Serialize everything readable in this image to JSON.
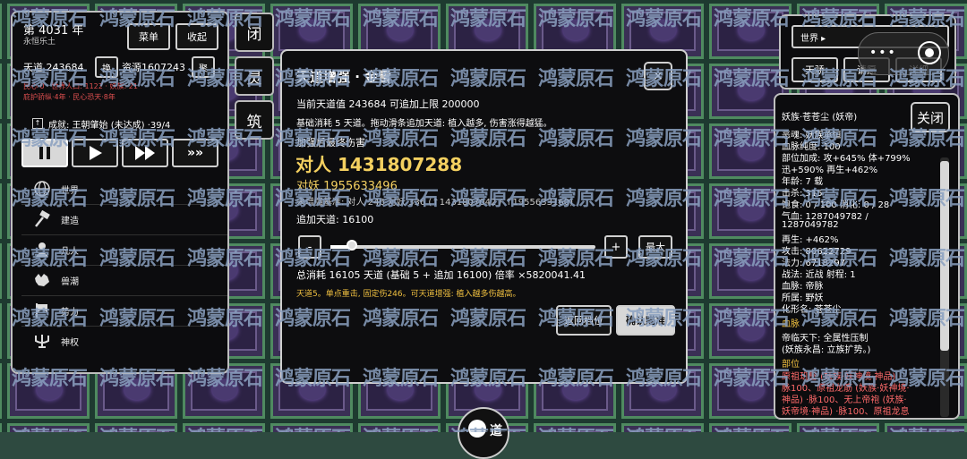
{
  "background": {
    "tile_text": "鸿蒙原石"
  },
  "top_left": {
    "year": "第 4031 年",
    "realm": "永恒乐土",
    "menu_label": "菜单",
    "collapse_label": "收起",
    "tiandao_label": "天道 243684",
    "swap_label": "换",
    "resource_label": "资源1607243",
    "gather_label": "聚",
    "stats_line1": "民心 0 · 世界人口: 1122 · 妖族: 21",
    "stats_line2": "庇护骄纵·4年 · 民心恐天·8年",
    "achievement_label": "成就: 王朝肇始 (未达成) ·39/4",
    "speed_buttons": [
      "pause",
      "play",
      "fast",
      "fastest"
    ],
    "nav_items": [
      {
        "icon": "globe-icon",
        "label": "世界"
      },
      {
        "icon": "hammer-icon",
        "label": "建造"
      },
      {
        "icon": "person-icon",
        "label": "凡人"
      },
      {
        "icon": "beast-icon",
        "label": "兽潮"
      },
      {
        "icon": "banner-icon",
        "label": "势力"
      },
      {
        "icon": "trident-icon",
        "label": "神权"
      }
    ]
  },
  "vertical_buttons": [
    "闭",
    "灵",
    "筑"
  ],
  "dialog": {
    "title": "天道增强 · 金雷",
    "close_symbol": "×",
    "line_current": "当前天道值  243684    可追加上限  200000",
    "line_cost": "基础消耗 5 天道。拖动滑条追加天道: 植入越多, 伤害涨得越猛。",
    "final_damage_label": "加强后最终伤害",
    "vs_human": "对人  1431807288",
    "vs_yao": "对妖  1955633496",
    "base_line": "未增强基准: 对人 246    对妖 336  (↑1431807042 / ↑1955633160)",
    "add_label": "追加天道: 16100",
    "minus_label": "-",
    "plus_label": "+",
    "max_label": "最大",
    "slider_fraction": 0.08,
    "total_line": "总消耗  16105 天道  (基础 5 + 追加 16100)      倍率 ×5820041.41",
    "note": "天道5。单点重击, 固定伤246。可天道增强: 植入越多伤越高。",
    "back_label": "返回档位",
    "confirm_label": "确认瞄准"
  },
  "top_right": {
    "world_label": "世界 ▸",
    "tab_labels": [
      "天骄",
      "请愿",
      "详细"
    ]
  },
  "detail": {
    "title": "妖族·苍苍尘 (妖帝)",
    "close_label": "关闭",
    "lines": [
      "恶魂: 妖族承恒",
      "血脉纯度: 100",
      "部位加成: 攻+645% 体+799%",
      "迅+590% 再生+462%",
      "年龄: 7 载",
      "击杀: 315",
      "饱食: 0 / 100  消化: 0 / 28",
      "气血: 1287049782 /",
      "1287049782",
      "再生: +462%",
      "攻击: 80622729",
      "法力: 6718297",
      "战法: 近战   射程: 1",
      "血脉: 帝脉",
      "所属: 野妖",
      "化形名: 苍苍尘"
    ],
    "bloodline_header": "血脉",
    "bloodline_lines": [
      "帝临天下: 全属性压制",
      "(妖族永昌: 立族扩势。)"
    ],
    "parts_header": "部位",
    "parts_lines": [
      "原祖玑髻 (妖族·妖神境·神品) ·",
      "脉100、原祖龙筋 (妖族·妖神境·",
      "神品) ·脉100、无上帝袍 (妖族·",
      "妖帝境·神品) ·脉100、原祖龙息",
      "(妖族·妖神境·神品) ·脉100"
    ]
  },
  "bottom_center": {
    "label": "道"
  },
  "colors": {
    "gold": "#f4d060",
    "accent_yellow": "#f0c040",
    "red_text": "#e05050",
    "parts_red": "#ff6a6a"
  }
}
